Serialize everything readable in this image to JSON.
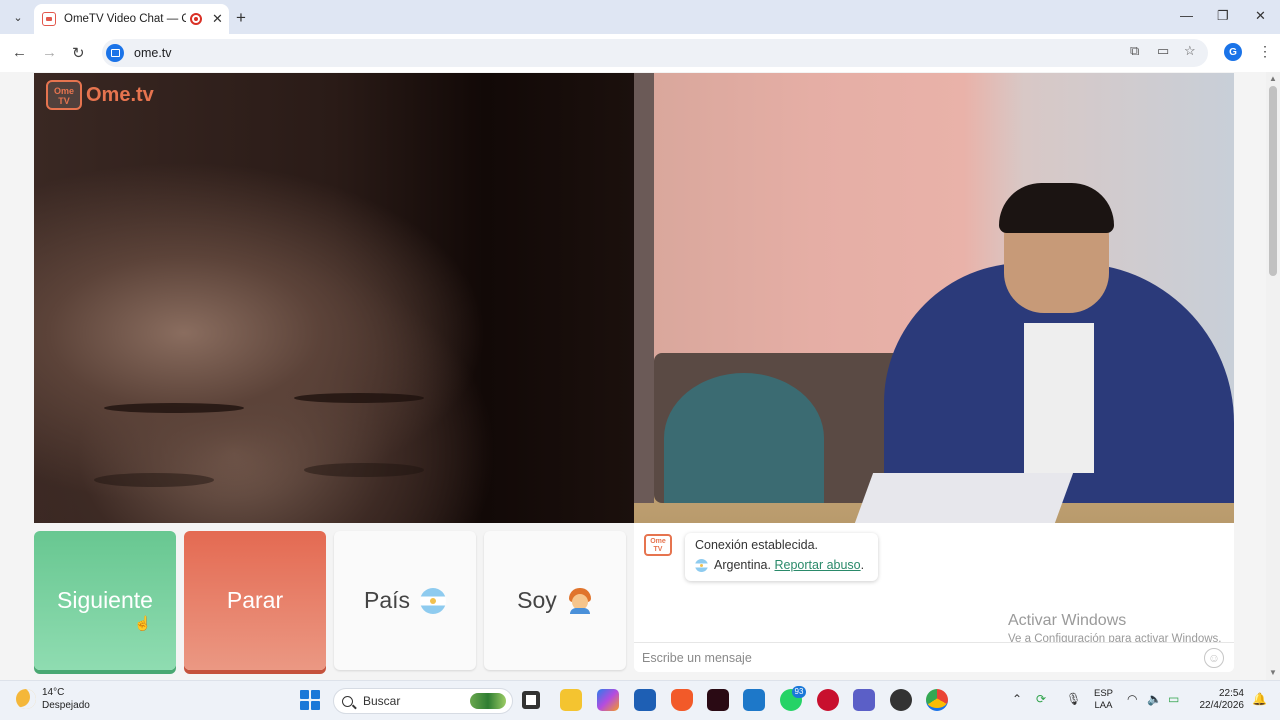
{
  "browser": {
    "tab_title": "OmeTV Video Chat — Ome",
    "tab_close": "✕",
    "new_tab": "+",
    "url": "ome.tv",
    "profile_initial": "G"
  },
  "video": {
    "logo_tv_text": "Ome TV",
    "logo_text": "Ome.tv"
  },
  "controls": {
    "next_label": "Siguiente",
    "stop_label": "Parar",
    "country_label": "País",
    "gender_label": "Soy"
  },
  "chat": {
    "logo_text": "Ome TV",
    "status": "Conexión establecida.",
    "country": "Argentina.",
    "report_link": "Reportar abuso",
    "report_suffix": ".",
    "input_placeholder": "Escribe un mensaje"
  },
  "watermark": {
    "line1": "Activar Windows",
    "line2": "Ve a Configuración para activar Windows."
  },
  "taskbar": {
    "temperature": "14°C",
    "weather": "Despejado",
    "search_placeholder": "Buscar",
    "whatsapp_badge": "93",
    "lang_line1": "ESP",
    "lang_line2": "LAA",
    "time": "22:54",
    "date": "22/4/2026"
  },
  "colors": {
    "next_button": "#68c791",
    "stop_button": "#e46a52",
    "brand": "#e6744f",
    "report_link": "#2a8a6a"
  }
}
